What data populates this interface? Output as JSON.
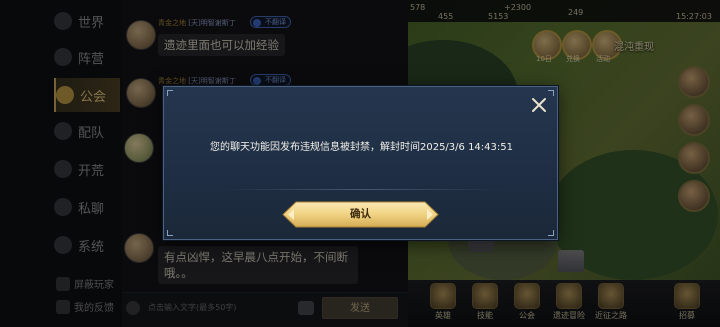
{
  "nav": {
    "items": [
      {
        "label": "世界",
        "active": false
      },
      {
        "label": "阵营",
        "active": false
      },
      {
        "label": "公会",
        "active": true
      },
      {
        "label": "配队",
        "active": false
      },
      {
        "label": "开荒",
        "active": false
      },
      {
        "label": "私聊",
        "active": false
      },
      {
        "label": "系统",
        "active": false
      }
    ],
    "bottom_buttons": [
      "屏蔽玩家",
      "我的反馈"
    ]
  },
  "chat": {
    "messages": [
      {
        "sender": "青金之地",
        "tag": "[天]",
        "name": "明智谢斯丁",
        "translate_label": "不翻译",
        "text": "遗迹里面也可以加经验"
      },
      {
        "sender": "青金之地",
        "tag": "[天]",
        "name": "明智谢斯丁",
        "translate_label": "不翻译",
        "text": ""
      },
      {
        "sender": "",
        "tag": "",
        "name": "",
        "translate_label": "",
        "text": "有点凶悍，这早晨八点开始，不间断哦。。"
      }
    ],
    "input_placeholder": "点击输入文字(最多50字)",
    "send_label": "发送"
  },
  "map": {
    "resources": [
      "578",
      "455",
      "5153",
      "+2300",
      "249",
      "15:27:03"
    ],
    "event_labels": [
      "10日",
      "兑换",
      "活动"
    ],
    "chaos_label": "混沌重现",
    "bottom_buttons": [
      "英雄",
      "技能",
      "公会",
      "遗迹冒险",
      "近征之路",
      "招募"
    ]
  },
  "dialog": {
    "message": "您的聊天功能因发布违规信息被封禁，解封时间2025/3/6 14:43:51",
    "confirm_label": "确认",
    "close_icon": "close-icon",
    "colors": {
      "panel": "#1f2e44",
      "button_gold": "#f2d88a",
      "border": "#4c6283"
    }
  }
}
